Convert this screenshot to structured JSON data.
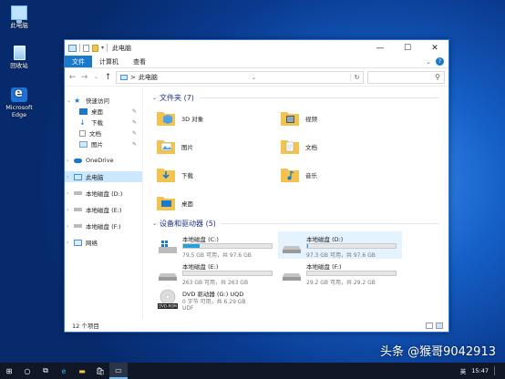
{
  "desktop": {
    "icons": [
      {
        "label": "此电脑",
        "icon": "computer-icon"
      },
      {
        "label": "回收站",
        "icon": "recycle-bin-icon"
      },
      {
        "label": "Microsoft Edge",
        "icon": "edge-icon"
      }
    ]
  },
  "window": {
    "title": "此电脑",
    "ribbon_tabs": [
      "文件",
      "计算机",
      "查看"
    ],
    "address": "此电脑",
    "address_sep": ">",
    "search_placeholder": "",
    "folders_header": "文件夹 (7)",
    "drives_header": "设备和驱动器 (5)",
    "folders": [
      {
        "name": "3D 对象",
        "icon": "3d-objects-icon"
      },
      {
        "name": "视频",
        "icon": "videos-icon"
      },
      {
        "name": "图片",
        "icon": "pictures-icon"
      },
      {
        "name": "文档",
        "icon": "documents-icon"
      },
      {
        "name": "下载",
        "icon": "downloads-icon"
      },
      {
        "name": "音乐",
        "icon": "music-icon"
      },
      {
        "name": "桌面",
        "icon": "desktop-folder-icon"
      }
    ],
    "drives": [
      {
        "name": "本地磁盘 (C:)",
        "free": "79.5 GB 可用，共 97.6 GB",
        "used_fraction": 0.19
      },
      {
        "name": "本地磁盘 (D:)",
        "free": "97.3 GB 可用，共 97.6 GB",
        "used_fraction": 0.003
      },
      {
        "name": "本地磁盘 (E:)",
        "free": "263 GB 可用，共 263 GB",
        "used_fraction": 0.0
      },
      {
        "name": "本地磁盘 (F:)",
        "free": "29.2 GB 可用，共 29.2 GB",
        "used_fraction": 0.0
      },
      {
        "name": "DVD 驱动器 (G:) UQD",
        "free": "0 字节 可用，共 6.29 GB",
        "fs": "UDF"
      }
    ],
    "sidebar": [
      {
        "label": "快速访问",
        "icon": "star-icon"
      },
      {
        "label": "桌面",
        "icon": "desktop-icon",
        "pin": "📌"
      },
      {
        "label": "下载",
        "icon": "download-icon",
        "pin": "📌"
      },
      {
        "label": "文档",
        "icon": "document-icon",
        "pin": "📌"
      },
      {
        "label": "图片",
        "icon": "picture-icon",
        "pin": "📌"
      },
      {
        "label": "OneDrive",
        "icon": "cloud-icon"
      },
      {
        "label": "此电脑",
        "icon": "computer-icon"
      },
      {
        "label": "本地磁盘 (D:)",
        "icon": "drive-icon"
      },
      {
        "label": "本地磁盘 (E:)",
        "icon": "drive-icon"
      },
      {
        "label": "本地磁盘 (F:)",
        "icon": "drive-icon"
      },
      {
        "label": "网络",
        "icon": "network-icon"
      }
    ],
    "status": "12 个项目"
  },
  "taskbar": {
    "time": "15:47",
    "lang": "英"
  },
  "watermark": "头条 @猴哥9042913",
  "colors": {
    "accent": "#1979ca",
    "folder": "#f3c24f",
    "selection": "#cce8ff",
    "drive_bar": "#26a0da"
  }
}
